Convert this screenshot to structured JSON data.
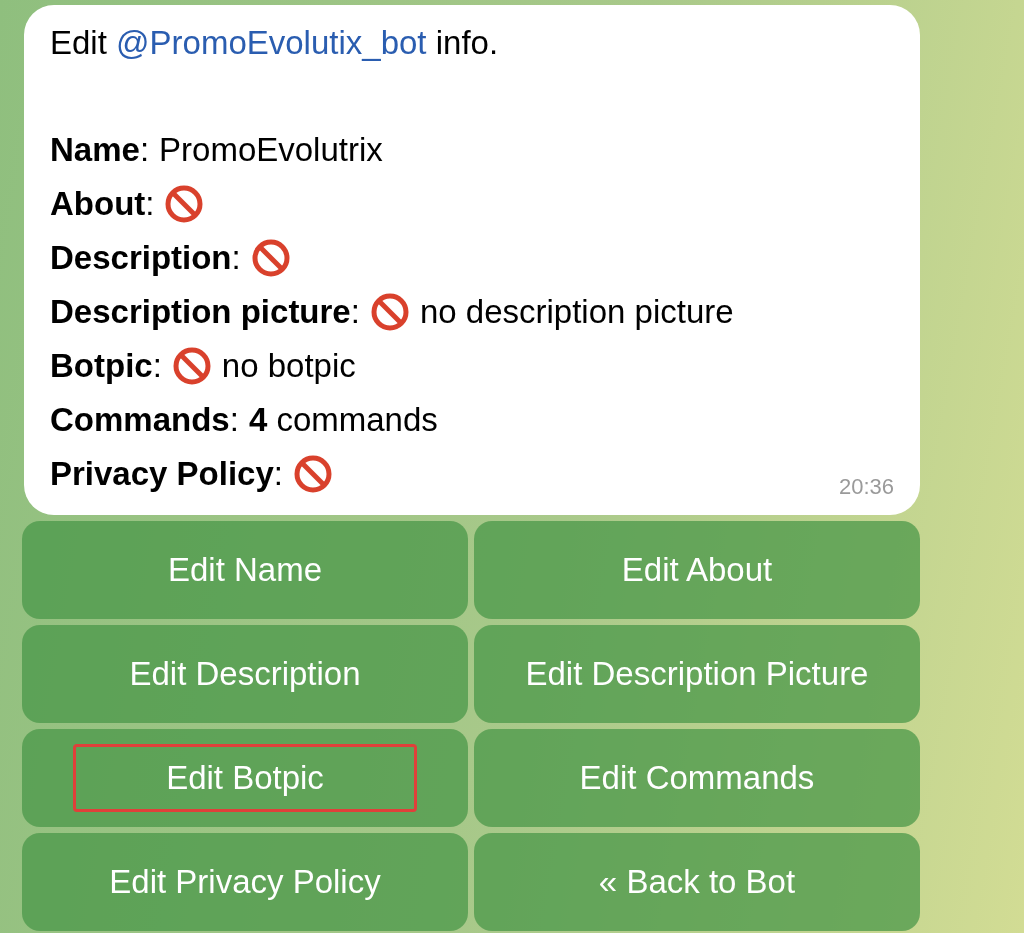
{
  "message": {
    "intro": {
      "before": "Edit ",
      "mention": "@PromoEvolutix_bot",
      "after": " info."
    },
    "fields": [
      {
        "label": "**Name**:",
        "not_set": false,
        "value": "PromoEvolutrix"
      },
      {
        "label": "**About**:",
        "not_set": true
      },
      {
        "label": "**Description**:",
        "not_set": true
      },
      {
        "label": "**Description picture**:",
        "not_set": true,
        "value": "no description picture"
      },
      {
        "label": "**Botpic**:",
        "not_set": true,
        "value": "no botpic"
      },
      {
        "label": "**Commands**:",
        "not_set": false,
        "value": "**4** commands"
      },
      {
        "label": "**Privacy Policy**:",
        "not_set": true
      }
    ],
    "time": "20:36"
  },
  "buttons": [
    {
      "label": "Edit Name",
      "outlined": false
    },
    {
      "label": "Edit About",
      "outlined": false
    },
    {
      "label": "Edit Description",
      "outlined": false
    },
    {
      "label": "Edit Description Picture",
      "outlined": false
    },
    {
      "label": "Edit Botpic",
      "outlined": true
    },
    {
      "label": "Edit Commands",
      "outlined": false
    },
    {
      "label": "Edit Privacy Policy",
      "outlined": false
    },
    {
      "label": "« Back to Bot",
      "outlined": false
    }
  ]
}
